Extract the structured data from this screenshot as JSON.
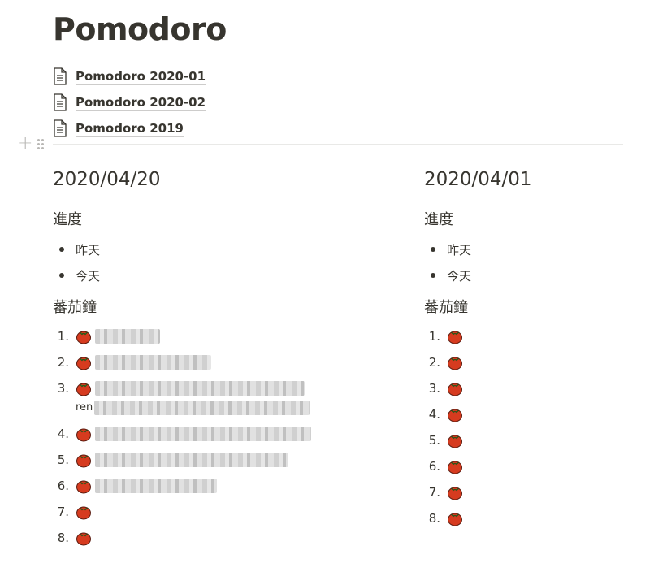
{
  "page": {
    "title": "Pomodoro"
  },
  "subpages": [
    {
      "label": "Pomodoro 2020-01"
    },
    {
      "label": "Pomodoro 2020-02"
    },
    {
      "label": "Pomodoro 2019"
    }
  ],
  "columns": [
    {
      "date": "2020/04/20",
      "progress_heading": "進度",
      "progress_items": [
        "昨天",
        "今天"
      ],
      "pomodoro_heading": "蕃茄鐘",
      "pomodoro_items": [
        "1.",
        "2.",
        "3.",
        "4.",
        "5.",
        "6.",
        "7.",
        "8."
      ],
      "wrapped_fragment": "ren"
    },
    {
      "date": "2020/04/01",
      "progress_heading": "進度",
      "progress_items": [
        "昨天",
        "今天"
      ],
      "pomodoro_heading": "蕃茄鐘",
      "pomodoro_items": [
        "1.",
        "2.",
        "3.",
        "4.",
        "5.",
        "6.",
        "7.",
        "8."
      ]
    }
  ],
  "icons": {
    "page": "document-icon",
    "item": "tomato-icon",
    "add": "plus-icon",
    "drag": "drag-handle-icon"
  }
}
